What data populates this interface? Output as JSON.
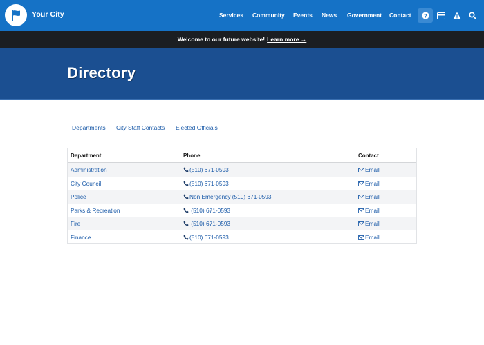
{
  "site": {
    "name": "Your City"
  },
  "nav": {
    "links": [
      "Services",
      "Community",
      "Events",
      "News",
      "Government",
      "Contact"
    ],
    "icons": [
      "question-icon",
      "card-icon",
      "alert-icon",
      "search-icon"
    ]
  },
  "banner": {
    "text": "Welcome to our future website!",
    "link": "Learn more →"
  },
  "hero": {
    "title": "Directory"
  },
  "tabs": [
    "Departments",
    "City Staff Contacts",
    "Elected Officials"
  ],
  "table": {
    "headers": [
      "Department",
      "Phone",
      "Contact"
    ],
    "rows": [
      {
        "department": "Administration",
        "phone": "(510) 671-0593",
        "contact": "Email"
      },
      {
        "department": "City Council",
        "phone": "(510) 671-0593",
        "contact": "Email"
      },
      {
        "department": "Police",
        "phone": "Non Emergency (510) 671-0593",
        "contact": "Email"
      },
      {
        "department": "Parks & Recreation",
        "phone": " (510) 671-0593",
        "contact": "Email"
      },
      {
        "department": "Fire",
        "phone": " (510) 671-0593",
        "contact": "Email"
      },
      {
        "department": "Finance",
        "phone": "(510) 671-0593",
        "contact": "Email"
      }
    ]
  },
  "colors": {
    "nav_bg": "#1572c6",
    "banner_bg": "#1b1e22",
    "hero_bg": "#1b4f91",
    "link": "#1a5aa8"
  }
}
